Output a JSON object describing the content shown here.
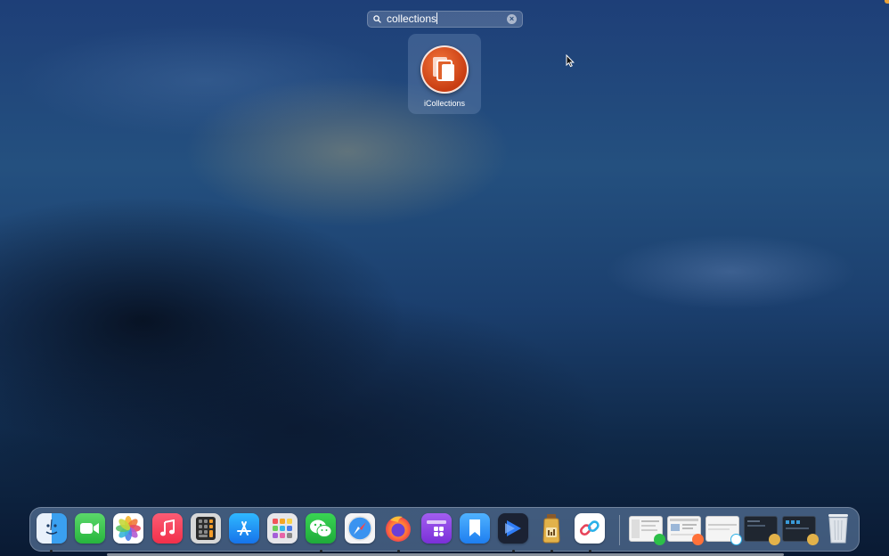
{
  "search": {
    "query": "collections"
  },
  "result": {
    "app_name": "iCollections"
  },
  "dock": {
    "apps": [
      {
        "name": "Finder",
        "icon": "finder-icon",
        "running": true
      },
      {
        "name": "FaceTime",
        "icon": "facetime-icon",
        "running": false
      },
      {
        "name": "Photos",
        "icon": "photos-icon",
        "running": false
      },
      {
        "name": "Music",
        "icon": "music-icon",
        "running": false
      },
      {
        "name": "Calculator",
        "icon": "calculator-icon",
        "running": false
      },
      {
        "name": "App Store",
        "icon": "app-store-icon",
        "running": false
      },
      {
        "name": "Launchpad",
        "icon": "launchpad-icon",
        "running": false
      },
      {
        "name": "WeChat",
        "icon": "wechat-icon",
        "running": true
      },
      {
        "name": "Safari",
        "icon": "safari-icon",
        "running": false
      },
      {
        "name": "Firefox",
        "icon": "firefox-icon",
        "running": true
      },
      {
        "name": "Widget app",
        "icon": "widget-app-icon",
        "running": false
      },
      {
        "name": "Bookmarks",
        "icon": "bookmark-icon",
        "running": false
      },
      {
        "name": "Video player",
        "icon": "video-player-icon",
        "running": true
      },
      {
        "name": "Jar app",
        "icon": "jar-icon",
        "running": true
      },
      {
        "name": "Link app",
        "icon": "link-app-icon",
        "running": true
      }
    ],
    "minimized": [
      {
        "name": "wechat-window-thumbnail",
        "badge": "wechat"
      },
      {
        "name": "firefox-window-thumbnail",
        "badge": "firefox"
      },
      {
        "name": "link-window-thumbnail",
        "badge": "link"
      },
      {
        "name": "jar-window-thumbnail-1",
        "badge": "jar"
      },
      {
        "name": "jar-window-thumbnail-2",
        "badge": "jar"
      }
    ],
    "trash": {
      "name": "Trash",
      "icon": "trash-icon"
    }
  },
  "colors": {
    "accent_orange": "#d9531e",
    "background_blue": "#1e4478"
  }
}
